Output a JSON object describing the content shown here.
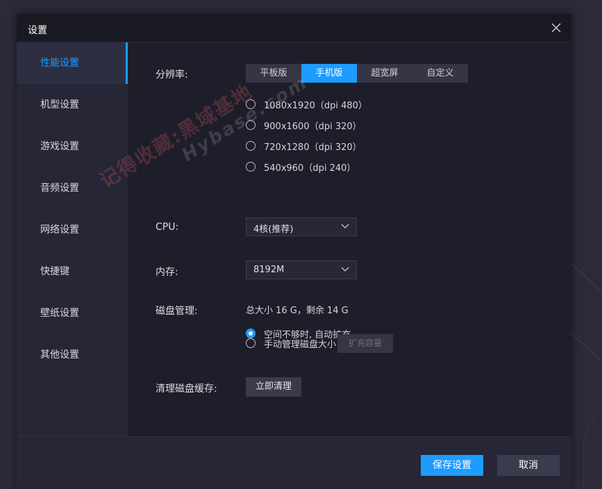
{
  "dialog": {
    "title": "设置"
  },
  "sidebar": {
    "items": [
      {
        "label": "性能设置",
        "active": true
      },
      {
        "label": "机型设置"
      },
      {
        "label": "游戏设置"
      },
      {
        "label": "音频设置"
      },
      {
        "label": "网络设置"
      },
      {
        "label": "快捷键"
      },
      {
        "label": "壁纸设置"
      },
      {
        "label": "其他设置"
      }
    ]
  },
  "performance": {
    "resolution": {
      "label": "分辨率:",
      "tabs": [
        "平板版",
        "手机版",
        "超宽屏",
        "自定义"
      ],
      "active_tab": "手机版",
      "options": [
        "1080x1920（dpi 480）",
        "900x1600（dpi 320）",
        "720x1280（dpi 320）",
        "540x960（dpi 240）"
      ]
    },
    "cpu": {
      "label": "CPU:",
      "value": "4核(推荐)"
    },
    "memory": {
      "label": "内存:",
      "value": "8192M"
    },
    "disk": {
      "label": "磁盘管理:",
      "info": "总大小 16 G，剩余 14 G",
      "option_auto": "空间不够时, 自动扩充",
      "option_manual": "手动管理磁盘大小",
      "expand_button": "扩充容量",
      "selected": "auto"
    },
    "cache": {
      "label": "清理磁盘缓存:",
      "button": "立即清理"
    }
  },
  "footer": {
    "save": "保存设置",
    "cancel": "取消"
  },
  "watermark": {
    "line1": "记得收藏:黑域基地",
    "line2": "Hybase.com"
  },
  "colors": {
    "accent": "#1e9bff",
    "dialog_bg": "#1f1f2c",
    "sidebar_bg": "#262636"
  }
}
